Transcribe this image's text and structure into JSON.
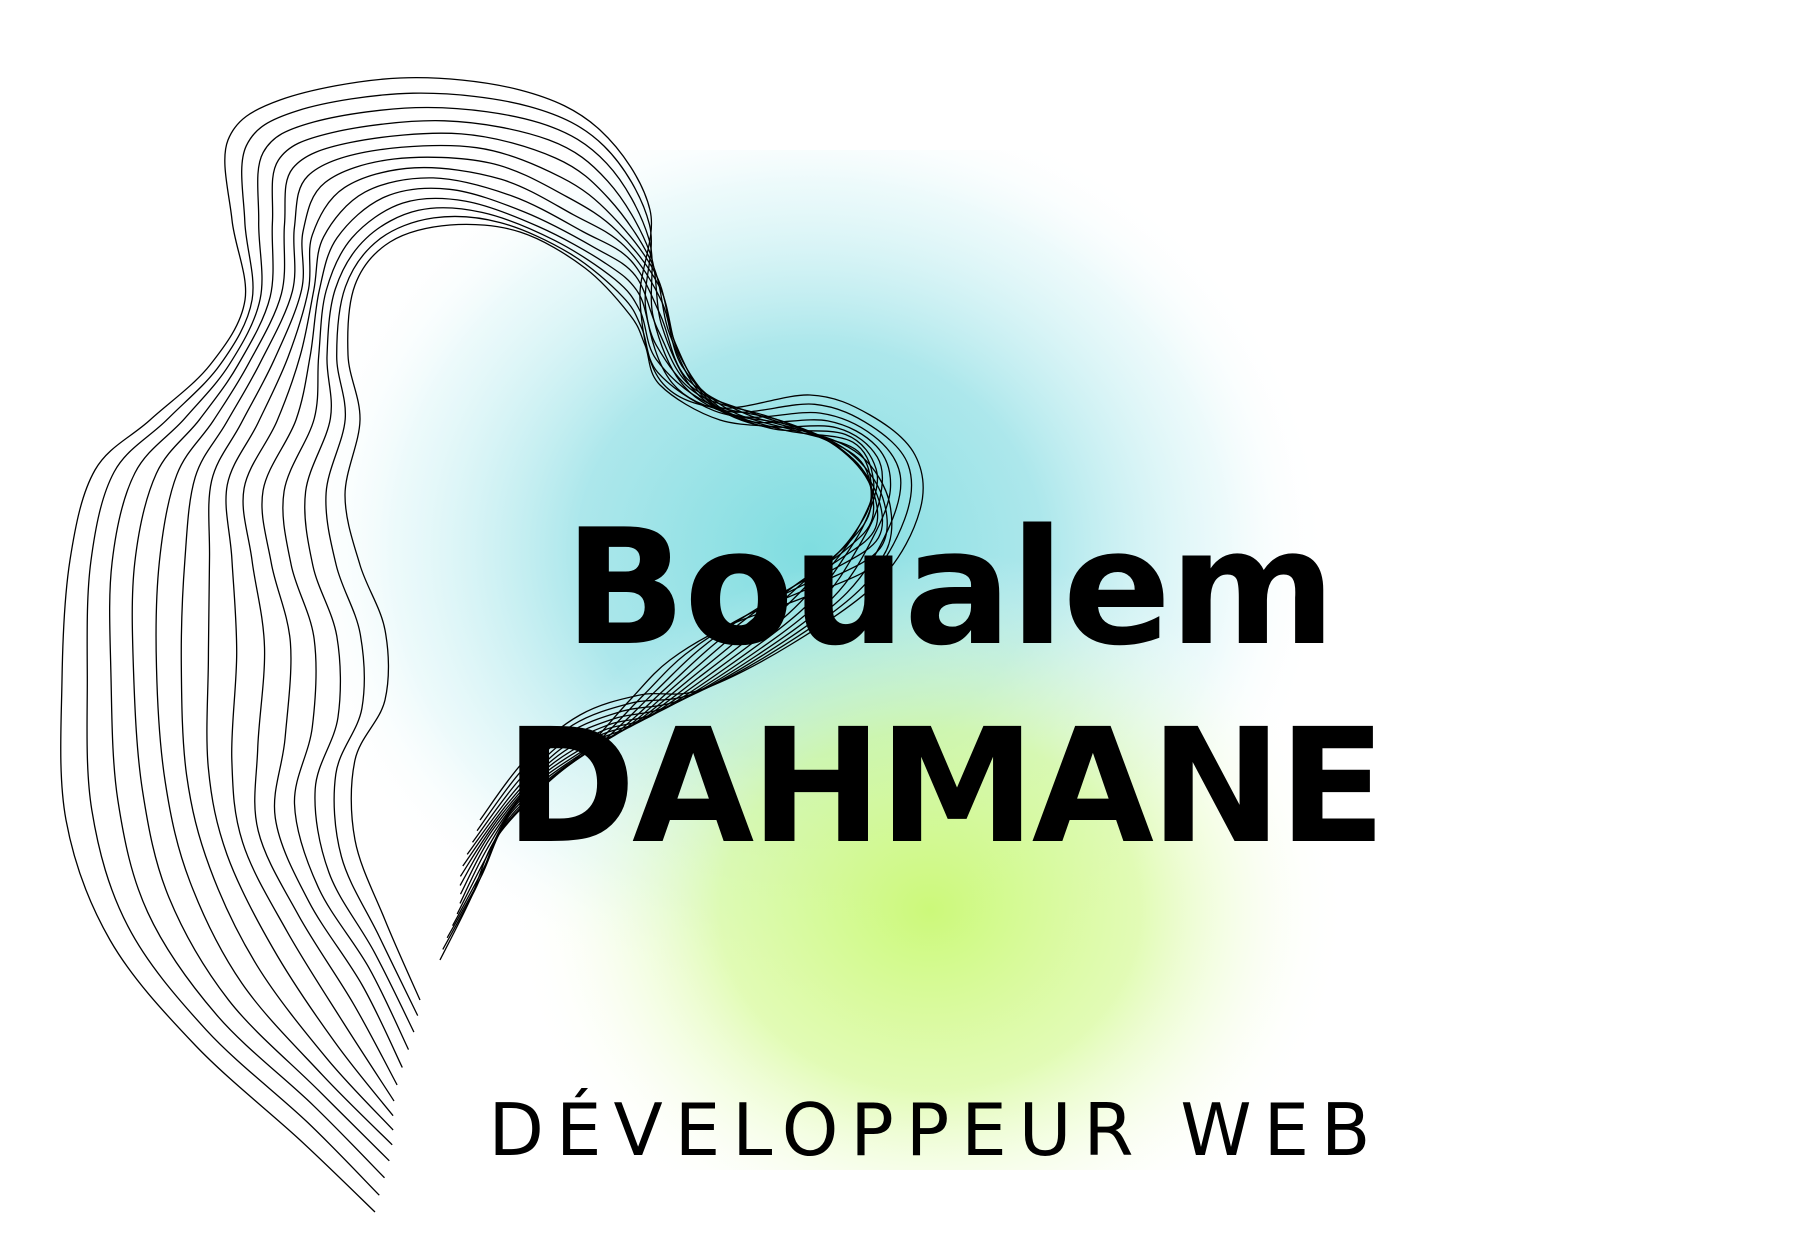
{
  "logo": {
    "first_name": "Boualem",
    "last_name": "DAHMANE",
    "role": "DÉVELOPPEUR WEB"
  },
  "colors": {
    "background": "#ffffff",
    "glow_cyan": "#7fdde0",
    "glow_lime": "#ccf97a",
    "text": "#000000",
    "lines": "#000000"
  }
}
